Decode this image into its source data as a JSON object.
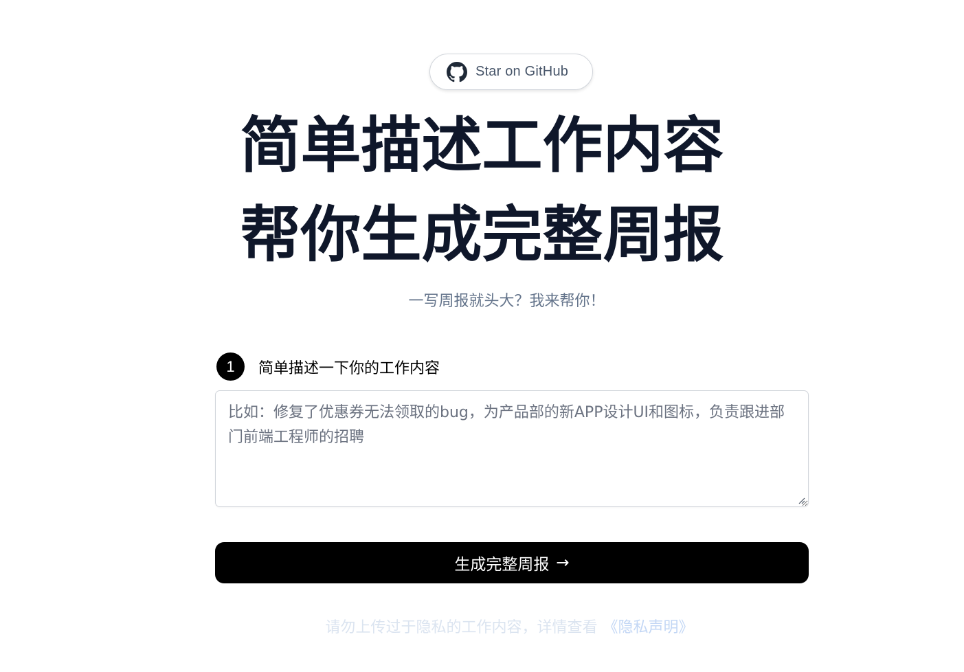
{
  "github_button": {
    "icon": "github-icon",
    "label": "Star on GitHub"
  },
  "hero": {
    "title_line1": "简单描述工作内容",
    "title_line2": "帮你生成完整周报",
    "subtitle": "一写周报就头大？我来帮你！"
  },
  "step1": {
    "number": "1",
    "label": "简单描述一下你的工作内容"
  },
  "work_input": {
    "value": "",
    "placeholder": "比如：修复了优惠券无法领取的bug，为产品部的新APP设计UI和图标，负责跟进部门前端工程师的招聘"
  },
  "generate_button": {
    "label": "生成完整周报",
    "arrow": "→"
  },
  "privacy_notice": {
    "text": "请勿上传过于隐私的工作内容，详情查看",
    "link_text": "《隐私声明》"
  },
  "colors": {
    "title": "#0f172a",
    "subtitle": "#64748b",
    "button_bg": "#000000",
    "notice_text": "#dbe4f0",
    "notice_link": "#c3d7f5"
  }
}
